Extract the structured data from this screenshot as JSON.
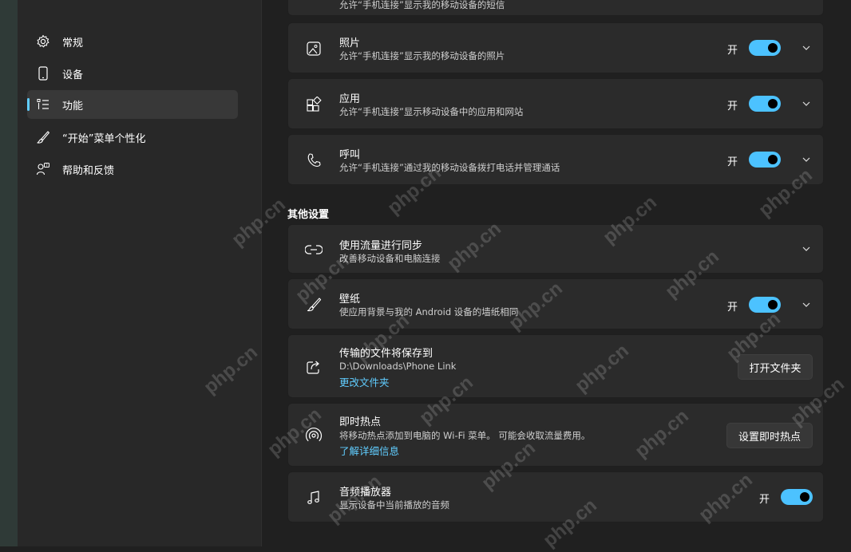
{
  "sidebar": {
    "items": [
      {
        "label": "常规",
        "icon": "gear-icon"
      },
      {
        "label": "设备",
        "icon": "phone-icon"
      },
      {
        "label": "功能",
        "icon": "feature-list-icon",
        "selected": true
      },
      {
        "label": "“开始”菜单个性化",
        "icon": "brush-icon"
      },
      {
        "label": "帮助和反馈",
        "icon": "help-person-icon"
      }
    ]
  },
  "content": {
    "top_card_desc": "允许“手机连接”显示我的移动设备的短信",
    "cards": [
      {
        "title": "照片",
        "desc": "允许“手机连接”显示我的移动设备的照片",
        "toggle_label": "开",
        "toggle_on": true
      },
      {
        "title": "应用",
        "desc": "允许“手机连接”显示移动设备中的应用和网站",
        "toggle_label": "开",
        "toggle_on": true
      },
      {
        "title": "呼叫",
        "desc": "允许“手机连接”通过我的移动设备拨打电话并管理通话",
        "toggle_label": "开",
        "toggle_on": true
      }
    ],
    "other_section_title": "其他设置",
    "other": {
      "sync": {
        "title": "使用流量进行同步",
        "desc": "改善移动设备和电脑连接"
      },
      "wallpaper": {
        "title": "壁纸",
        "desc": "使应用背景与我的 Android 设备的墙纸相同",
        "toggle_label": "开",
        "toggle_on": true
      },
      "files": {
        "title": "传输的文件将保存到",
        "path": "D:\\Downloads\\Phone Link",
        "link": "更改文件夹",
        "button": "打开文件夹"
      },
      "hotspot": {
        "title": "即时热点",
        "desc": "将移动热点添加到电脑的 Wi-Fi 菜单。 可能会收取流量费用。",
        "link": "了解详细信息",
        "button": "设置即时热点"
      },
      "audio": {
        "title": "音频播放器",
        "desc": "显示设备中当前播放的音频",
        "toggle_label": "开",
        "toggle_on": true
      }
    }
  },
  "watermark": "php.cn",
  "colors": {
    "accent": "#4cc2ff",
    "link": "#60cdff",
    "card_bg": "#2b2b2b",
    "page_bg": "#202020"
  }
}
